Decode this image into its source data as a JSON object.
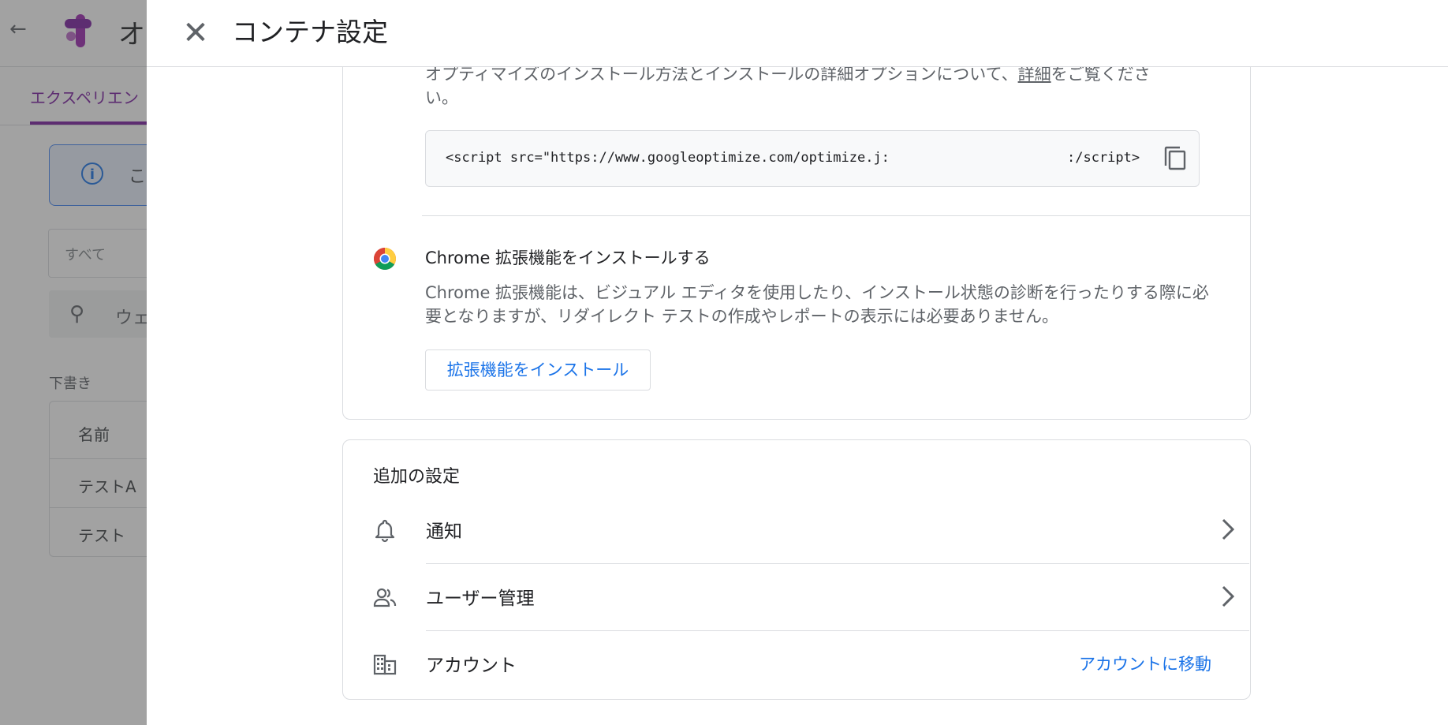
{
  "background": {
    "title_partial": "オ",
    "tab_partial": "エクスペリエン",
    "info_partial": "こ",
    "filter_placeholder": "すべて",
    "search_partial": "ウェ",
    "section_label": "下書き",
    "table": {
      "header": "名前",
      "rows": [
        "テストA",
        "テスト"
      ]
    }
  },
  "dialog": {
    "title": "コンテナ設定",
    "install": {
      "desc_before": "オプティマイズのインストール方法とインストールの詳細オプションについて、",
      "desc_link": "詳細",
      "desc_after": "をご覧ください。",
      "code_snippet_start": "<script src=\"https://www.googleoptimize.com/optimize.j:",
      "code_snippet_end": ":/script>"
    },
    "chrome": {
      "title": "Chrome 拡張機能をインストールする",
      "description": "Chrome 拡張機能は、ビジュアル エディタを使用したり、インストール状態の診断を行ったりする際に必要となりますが、リダイレクト テストの作成やレポートの表示には必要ありません。",
      "button_label": "拡張機能をインストール"
    },
    "additional": {
      "title": "追加の設定",
      "notifications_label": "通知",
      "user_management_label": "ユーザー管理",
      "account_label": "アカウント",
      "account_link": "アカウントに移動"
    }
  },
  "icons": {
    "close": "close-icon",
    "copy": "copy-icon",
    "chrome": "chrome-logo-icon",
    "bell": "bell-icon",
    "users": "users-icon",
    "building": "building-icon",
    "chevron": "chevron-right-icon"
  },
  "colors": {
    "accent_blue": "#1a73e8",
    "optimize_purple": "#7b1fa2",
    "scrim": "rgba(60,60,60,0.48)"
  }
}
